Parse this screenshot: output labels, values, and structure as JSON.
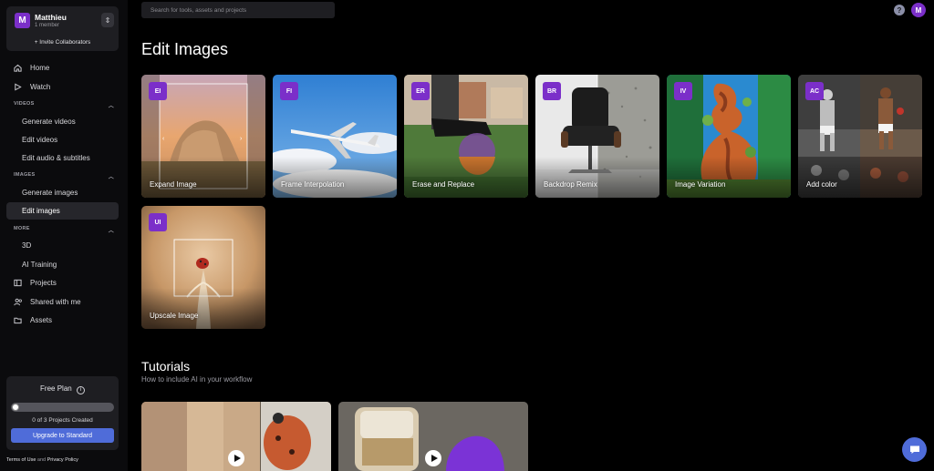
{
  "workspace": {
    "avatar_letter": "M",
    "name": "Matthieu",
    "members": "1 member",
    "switch_icon": "⇕",
    "invite": "+ Invite Collaborators"
  },
  "nav": {
    "home": "Home",
    "watch": "Watch",
    "videos_section": "VIDEOS",
    "generate_videos": "Generate videos",
    "edit_videos": "Edit videos",
    "edit_audio": "Edit audio & subtitles",
    "images_section": "IMAGES",
    "generate_images": "Generate images",
    "edit_images": "Edit images",
    "more_section": "MORE",
    "three_d": "3D",
    "ai_training": "AI Training",
    "projects": "Projects",
    "shared": "Shared with me",
    "assets": "Assets"
  },
  "plan": {
    "title": "Free Plan",
    "info_icon": "i",
    "projects_used": 0,
    "projects_limit": 3,
    "count_text": "0 of 3 Projects Created",
    "upgrade": "Upgrade to Standard"
  },
  "legal": {
    "terms": "Terms of Use",
    "and": " and ",
    "privacy": "Privacy Policy"
  },
  "search": {
    "placeholder": "Search for tools, assets and projects"
  },
  "header": {
    "help": "?",
    "user_letter": "M"
  },
  "main": {
    "title": "Edit Images",
    "cards": [
      {
        "badge": "EI",
        "label": "Expand Image"
      },
      {
        "badge": "FI",
        "label": "Frame Interpolation"
      },
      {
        "badge": "ER",
        "label": "Erase and Replace"
      },
      {
        "badge": "BR",
        "label": "Backdrop Remix"
      },
      {
        "badge": "IV",
        "label": "Image Variation"
      },
      {
        "badge": "AC",
        "label": "Add color"
      },
      {
        "badge": "UI",
        "label": "Upscale Image"
      }
    ],
    "tutorials_title": "Tutorials",
    "tutorials_sub": "How to include AI in your workflow"
  },
  "colors": {
    "accent": "#7b2fc9",
    "primary_button": "#4f6cd9",
    "background": "#000000",
    "panel": "#1e1e22"
  }
}
